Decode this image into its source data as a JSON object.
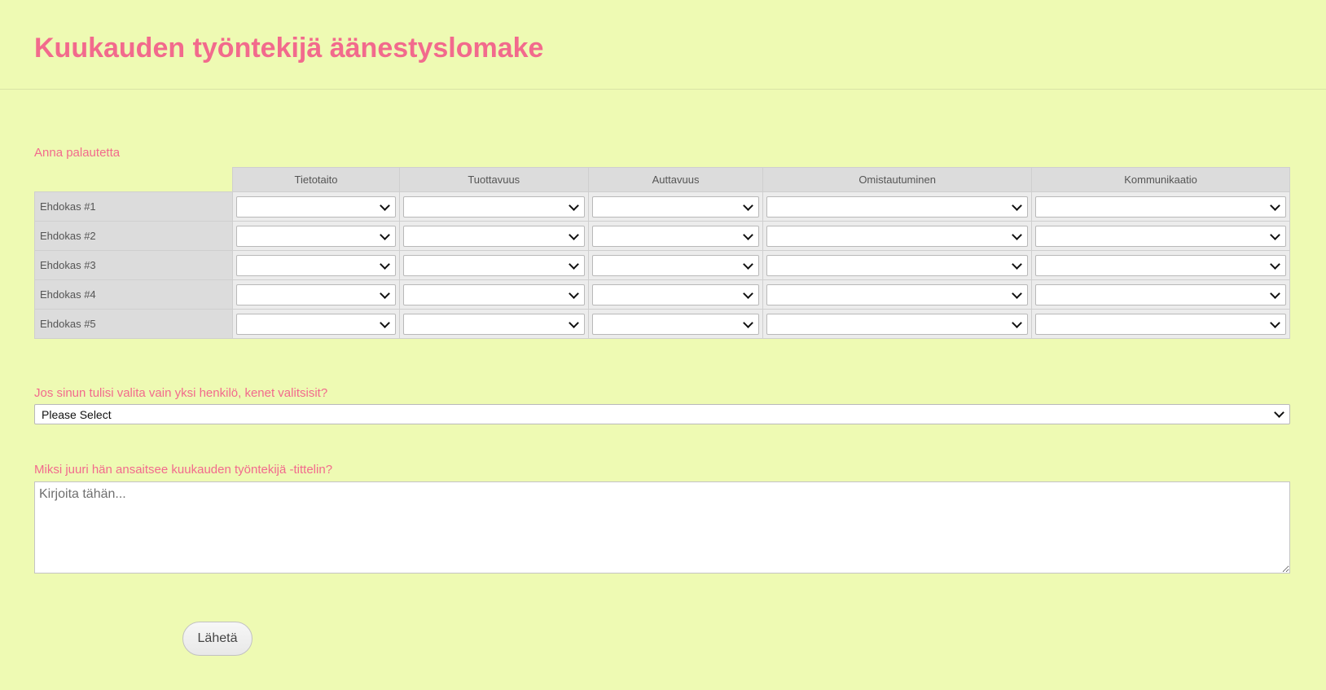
{
  "form": {
    "title": "Kuukauden työntekijä äänestyslomake"
  },
  "matrix": {
    "label": "Anna palautetta",
    "columns": [
      "Tietotaito",
      "Tuottavuus",
      "Auttavuus",
      "Omistautuminen",
      "Kommunikaatio"
    ],
    "rows": [
      "Ehdokas #1",
      "Ehdokas #2",
      "Ehdokas #3",
      "Ehdokas #4",
      "Ehdokas #5"
    ]
  },
  "choice": {
    "label": "Jos sinun tulisi valita vain yksi henkilö, kenet valitsisit?",
    "selected": "Please Select"
  },
  "reason": {
    "label": "Miksi juuri hän ansaitsee kuukauden työntekijä -tittelin?",
    "placeholder": "Kirjoita tähän..."
  },
  "submit": {
    "label": "Lähetä"
  },
  "colors": {
    "background": "#eefab3",
    "accent": "#f26a8d"
  }
}
